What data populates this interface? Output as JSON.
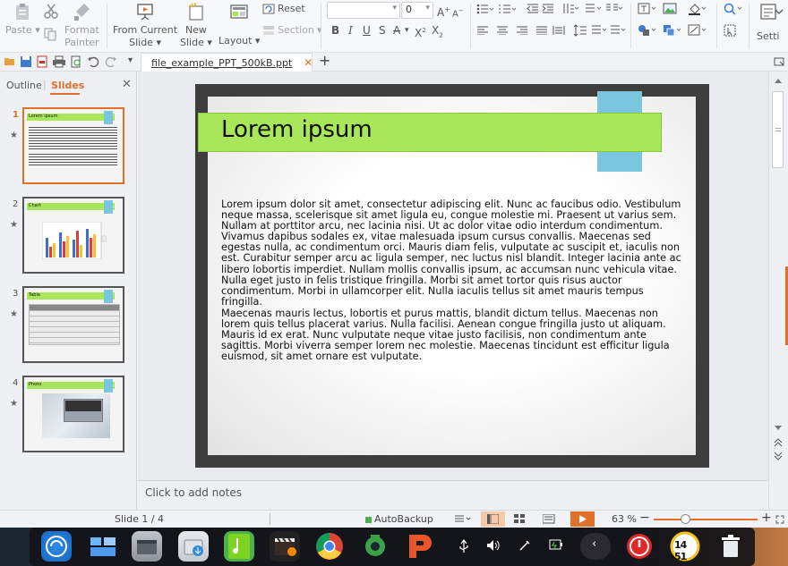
{
  "ribbon": {
    "paste_label": "Paste",
    "format_painter_label_1": "Format",
    "format_painter_label_2": "Painter",
    "from_current_label_1": "From Current",
    "from_current_label_2": "Slide",
    "new_slide_label_1": "New",
    "new_slide_label_2": "Slide",
    "layout_label": "Layout",
    "reset_label": "Reset",
    "section_label": "Section",
    "font_size_value": "0",
    "settings_label": "Setti"
  },
  "document_tab": {
    "filename": "file_example_PPT_500kB.ppt"
  },
  "left_pane": {
    "tab_outline": "Outline",
    "tab_slides": "Slides",
    "slides": [
      {
        "number": "1",
        "title": "Lorem ipsum"
      },
      {
        "number": "2",
        "title": "Chart"
      },
      {
        "number": "3",
        "title": "Table"
      },
      {
        "number": "4",
        "title": "Photo"
      }
    ]
  },
  "slide": {
    "title": "Lorem ipsum",
    "paragraph1": "Lorem ipsum dolor sit amet, consectetur adipiscing elit. Nunc ac faucibus odio. Vestibulum neque massa, scelerisque sit amet ligula eu, congue molestie mi. Praesent ut varius sem. Nullam at porttitor arcu, nec lacinia nisi. Ut ac dolor vitae odio interdum condimentum. Vivamus dapibus sodales ex, vitae malesuada ipsum cursus convallis. Maecenas sed egestas nulla, ac condimentum orci. Mauris diam felis, vulputate ac suscipit et, iaculis non est. Curabitur semper arcu ac ligula semper, nec luctus nisl blandit. Integer lacinia ante ac libero lobortis imperdiet. Nullam mollis convallis ipsum, ac accumsan nunc vehicula vitae. Nulla eget justo in felis tristique fringilla. Morbi sit amet tortor quis risus auctor condimentum. Morbi in ullamcorper elit. Nulla iaculis tellus sit amet mauris tempus fringilla.",
    "paragraph2": "Maecenas mauris lectus, lobortis et purus mattis, blandit dictum tellus. Maecenas non lorem quis tellus placerat varius. Nulla facilisi. Aenean congue fringilla justo ut aliquam. Mauris id ex erat. Nunc vulputate neque vitae justo facilisis, non condimentum ante sagittis. Morbi viverra semper lorem nec molestie. Maecenas tincidunt est efficitur ligula euismod, sit amet ornare est vulputate."
  },
  "notes": {
    "placeholder": "Click to add notes"
  },
  "status": {
    "slide_indicator": "Slide 1 / 4",
    "autobackup_label": "AutoBackup",
    "zoom_level": "63 %",
    "zoom_fraction": 0.63
  },
  "taskbar": {
    "clock_label": "14 51"
  },
  "colors": {
    "accent_orange": "#e0702a",
    "title_green": "#a9e65a",
    "title_blue_tab": "#7ac6df"
  }
}
